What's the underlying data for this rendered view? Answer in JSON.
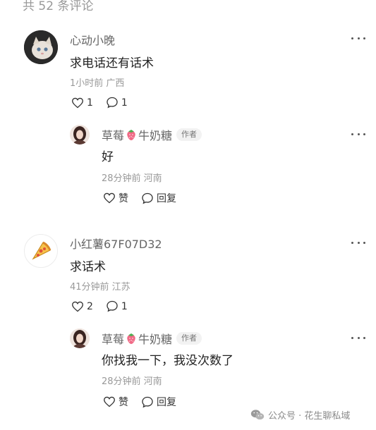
{
  "header": {
    "comment_count_label": "共 52 条评论"
  },
  "comments": [
    {
      "user": "心动小晚",
      "text": "求电话还有话术",
      "meta": "1小时前 广西",
      "likes": "1",
      "replies": "1",
      "reply": {
        "user": "草莓🍓牛奶糖",
        "user_part1": "草莓",
        "user_part2": "牛奶糖",
        "author_tag": "作者",
        "text": "好",
        "meta": "28分钟前 河南",
        "like_label": "赞",
        "reply_label": "回复"
      }
    },
    {
      "user": "小红薯67F07D32",
      "text": "求话术",
      "meta": "41分钟前 江苏",
      "likes": "2",
      "replies": "1",
      "reply": {
        "user": "草莓🍓牛奶糖",
        "user_part1": "草莓",
        "user_part2": "牛奶糖",
        "author_tag": "作者",
        "text": "你找我一下，我没次数了",
        "meta": "28分钟前 河南",
        "like_label": "赞",
        "reply_label": "回复"
      }
    }
  ],
  "watermark": {
    "label": "公众号 · 花生聊私域"
  },
  "icons": [
    "heart-icon",
    "comment-icon",
    "more-icon",
    "strawberry-icon",
    "wechat-icon"
  ]
}
